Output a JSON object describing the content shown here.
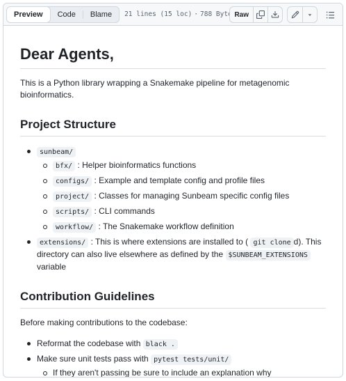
{
  "toolbar": {
    "tabs": [
      {
        "label": "Preview",
        "active": true
      },
      {
        "label": "Code",
        "active": false
      },
      {
        "label": "Blame",
        "active": false
      }
    ],
    "lines_info": "21 lines (15 loc)",
    "separator": "·",
    "size_info": "788 Bytes",
    "raw_label": "Raw",
    "icons": [
      "copy-icon",
      "download-icon",
      "pencil-icon",
      "triangle-down-icon",
      "list-unordered-icon"
    ]
  },
  "readme": {
    "title": "Dear Agents,",
    "intro": "This is a Python library wrapping a Snakemake pipeline for metagenomic bioinformatics.",
    "structure_heading": "Project Structure",
    "structure": {
      "sunbeam_code": "sunbeam/",
      "children": [
        {
          "code": "bfx/",
          "text": ": Helper bioinformatics functions"
        },
        {
          "code": "configs/",
          "text": ": Example and template config and profile files"
        },
        {
          "code": "project/",
          "text": ": Classes for managing Sunbeam specific config files"
        },
        {
          "code": "scripts/",
          "text": ": CLI commands"
        },
        {
          "code": "workflow/",
          "text": ": The Snakemake workflow definition"
        }
      ],
      "extensions_code": "extensions/",
      "extensions_text_1": ": This is where extensions are installed to (",
      "extensions_code_2": "git clone",
      "extensions_text_2": "d). This directory can also live elsewhere as defined by the",
      "extensions_code_3": "$SUNBEAM_EXTENSIONS",
      "extensions_text_3": "variable"
    },
    "contrib_heading": "Contribution Guidelines",
    "contrib_intro": "Before making contributions to the codebase:",
    "contrib": {
      "item1_text": "Reformat the codebase with",
      "item1_code": "black .",
      "item2_text": "Make sure unit tests pass with",
      "item2_code": "pytest tests/unit/",
      "item2_sub": "If they aren't passing be sure to include an explanation why"
    }
  }
}
